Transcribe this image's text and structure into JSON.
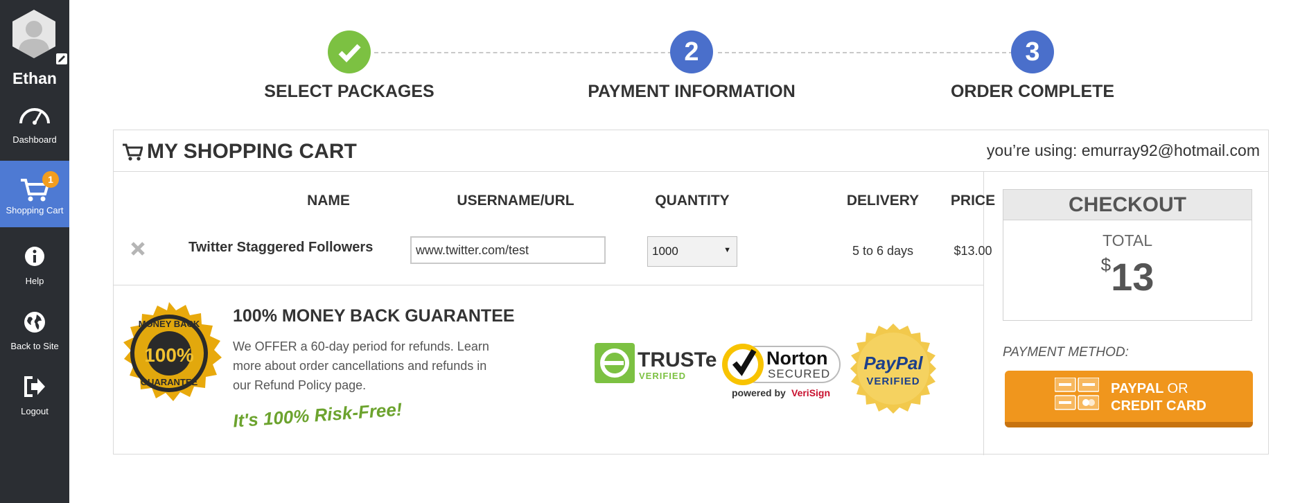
{
  "user": {
    "name": "Ethan"
  },
  "sidebar": {
    "items": [
      {
        "label": "Dashboard",
        "icon": "speedometer-icon"
      },
      {
        "label": "Shopping Cart",
        "icon": "cart-icon",
        "badge": "1",
        "active": true
      },
      {
        "label": "Help",
        "icon": "info-icon"
      },
      {
        "label": "Back to Site",
        "icon": "globe-icon"
      },
      {
        "label": "Logout",
        "icon": "logout-icon"
      }
    ]
  },
  "steps": [
    {
      "label": "SELECT PACKAGES",
      "number": "",
      "state": "done"
    },
    {
      "label": "PAYMENT INFORMATION",
      "number": "2",
      "state": "todo"
    },
    {
      "label": "ORDER COMPLETE",
      "number": "3",
      "state": "todo"
    }
  ],
  "cart": {
    "title": "MY SHOPPING CART",
    "using": "you’re using: emurray92@hotmail.com",
    "columns": {
      "name": "NAME",
      "url": "USERNAME/URL",
      "quantity": "QUANTITY",
      "delivery": "DELIVERY",
      "price": "PRICE"
    },
    "item": {
      "name": "Twitter Staggered Followers",
      "url": "www.twitter.com/test",
      "quantity": "1000",
      "delivery": "5 to 6 days",
      "price": "$13.00"
    }
  },
  "guarantee": {
    "title": "100% MONEY BACK GUARANTEE",
    "text": "We OFFER a 60-day period for refunds. Learn more about order cancellations and refunds in our Refund Policy page.",
    "tagline": "It's 100% Risk-Free!",
    "seal": {
      "top": "MONEY BACK",
      "center": "100%",
      "bottom": "GUARANTEE"
    }
  },
  "badges": {
    "truste": {
      "name": "TRUSTe",
      "sub": "VERIFIED"
    },
    "norton": {
      "name": "Norton",
      "sub": "SECURED",
      "powered": "powered by",
      "brand": "VeriSign"
    },
    "paypal": {
      "name": "PayPal",
      "sub": "VERIFIED"
    }
  },
  "checkout": {
    "title": "CHECKOUT",
    "total_label": "TOTAL",
    "currency": "$",
    "total": "13",
    "payment_label": "PAYMENT METHOD:",
    "pay_line1": "PAYPAL",
    "pay_or": "OR",
    "pay_line2": "CREDIT CARD"
  },
  "colors": {
    "sidebar": "#2b2e33",
    "active": "#4e7ad3",
    "step_done": "#7cc142",
    "step_todo": "#4a6fcb",
    "pay_button": "#f0961d"
  }
}
